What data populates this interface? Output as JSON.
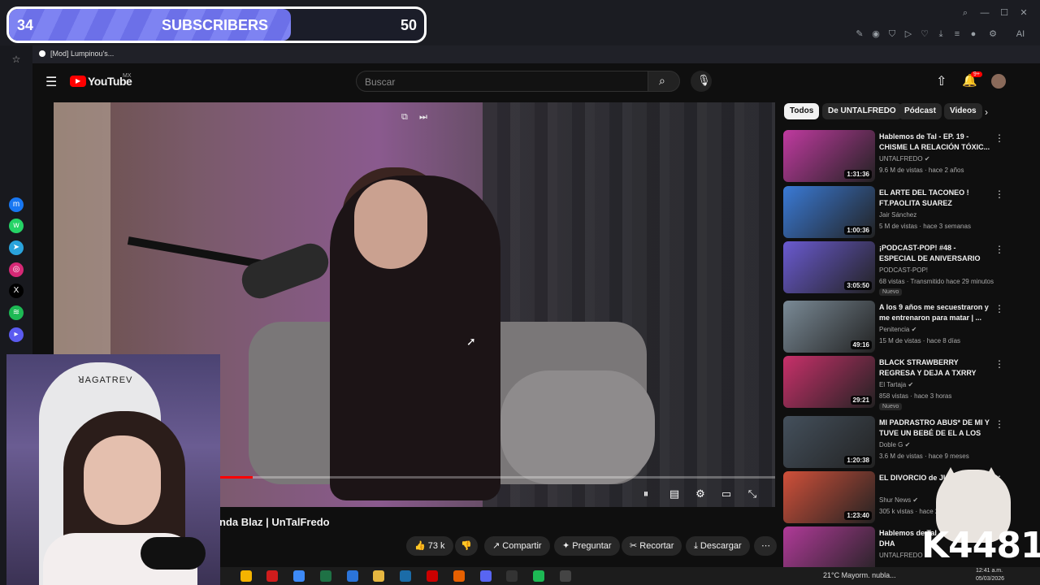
{
  "overlay": {
    "goal_current": "34",
    "goal_label": "SUBSCRIBERS",
    "goal_target": "50",
    "goal_fraction": 0.68
  },
  "browser": {
    "tab_title": "[Mod] Lumpinou's..."
  },
  "youtube": {
    "logo_text": "YouTube",
    "region": "MX",
    "search_placeholder": "Buscar",
    "notification_count": "9+",
    "chips": [
      "Todos",
      "De UNTALFREDO",
      "Pódcast",
      "Videos"
    ]
  },
  "video": {
    "title_visible": "nda Blaz | UnTalFredo",
    "played_fraction": 0.276,
    "likes": "73 k",
    "actions": [
      "Compartir",
      "Preguntar",
      "Recortar",
      "Descargar"
    ]
  },
  "webcam": {
    "chair_text": "ꓤAGATREV"
  },
  "recommendations": [
    {
      "title": "Hablemos de Tal - EP. 19 - CHISME LA RELACIÓN TÓXIC...",
      "channel": "UNTALFREDO",
      "verified": true,
      "meta": "9.6 M de vistas · hace 2 años",
      "duration": "1:31:36",
      "badge": "",
      "color": "#c03aa0"
    },
    {
      "title": "EL ARTE DEL TACONEO ! FT.PAOLITA SUAREZ",
      "channel": "Jair Sánchez",
      "verified": false,
      "meta": "5 M de vistas · hace 3 semanas",
      "duration": "1:00:36",
      "badge": "",
      "color": "#3a7ad6"
    },
    {
      "title": "¡PODCAST-POP! #48 - ESPECIAL DE ANIVERSARIO",
      "channel": "PODCAST-POP!",
      "verified": false,
      "meta": "68 vistas · Transmitido hace 29 minutos",
      "duration": "3:05:50",
      "badge": "Nuevo",
      "color": "#6a5ad0"
    },
    {
      "title": "A los 9 años me secuestraron y me entrenaron para matar | ...",
      "channel": "Penitencia",
      "verified": true,
      "meta": "15 M de vistas · hace 8 días",
      "duration": "49:16",
      "badge": "",
      "color": "#7a8a96"
    },
    {
      "title": "BLACK STRAWBERRY REGRESA Y DEJA A TXRRY COMO ...",
      "channel": "El Tartaja",
      "verified": true,
      "meta": "858 vistas · hace 3 horas",
      "duration": "29:21",
      "badge": "Nuevo",
      "color": "#c8306a"
    },
    {
      "title": "MI PADRASTRO ABUS* DE MI Y TUVE UN BEBÉ DE EL A LOS 1...",
      "channel": "Doble G",
      "verified": true,
      "meta": "3.6 M de vistas · hace 9 meses",
      "duration": "1:20:38",
      "badge": "",
      "color": "#44505c"
    },
    {
      "title": "EL DIVORCIO de JUANSGUARNI",
      "channel": "Shur News",
      "verified": true,
      "meta": "305 k vistas · hace 2",
      "duration": "1:23:40",
      "badge": "",
      "color": "#d0503a"
    },
    {
      "title": "Hablemos de Tal - E CHISME DHA",
      "channel": "UNTALFREDO",
      "verified": false,
      "meta": "",
      "duration": "",
      "badge": "",
      "color": "#b03a98"
    }
  ],
  "taskbar": {
    "weather": "21°C  Mayorm. nubla...",
    "time": "12:41 a.m.",
    "date": "05/03/2026"
  },
  "watermark": "K4481"
}
